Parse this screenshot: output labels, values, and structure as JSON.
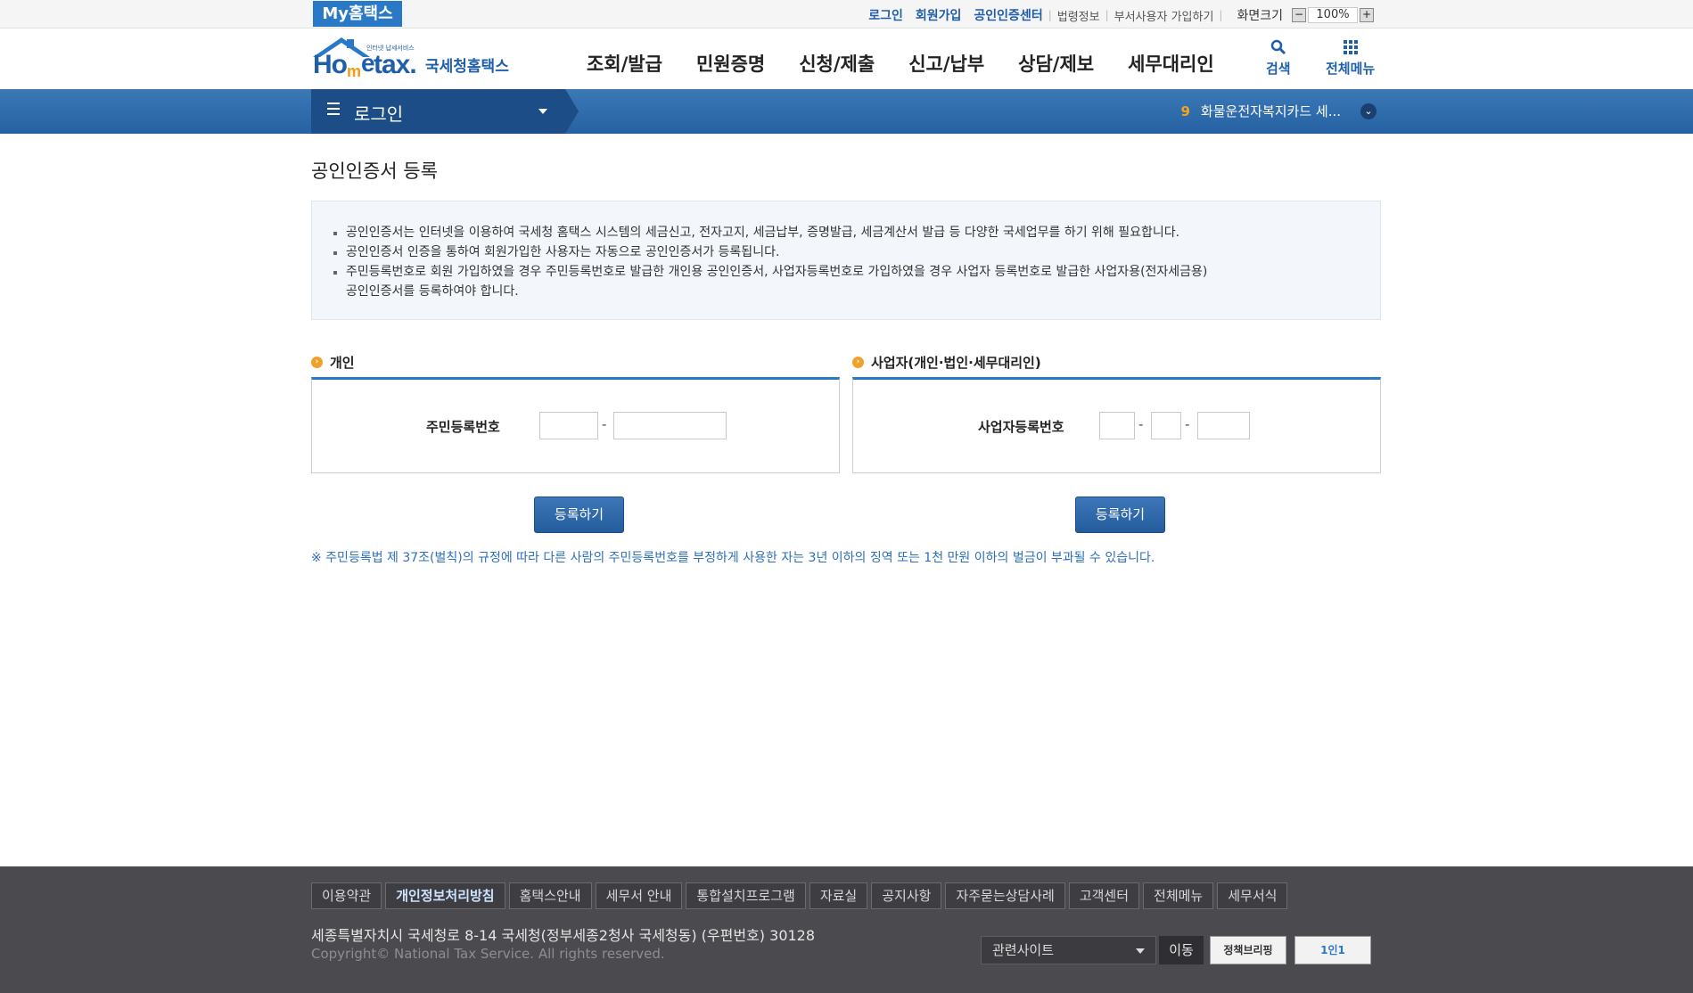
{
  "topbar": {
    "my_hometax": "My홈택스",
    "links": [
      "로그인",
      "회원가입",
      "공인인증센터"
    ],
    "sub_links": [
      "법령정보",
      "부서사용자 가입하기"
    ],
    "zoom_label": "화면크기",
    "zoom_minus": "−",
    "zoom_value": "100%",
    "zoom_plus": "+"
  },
  "header": {
    "logo_small": "인터넷 납세서비스",
    "logo_main": "Hometax",
    "logo_kor": "국세청홈택스",
    "nav": [
      "조회/발급",
      "민원증명",
      "신청/제출",
      "신고/납부",
      "상담/제보",
      "세무대리인"
    ],
    "search_label": "검색",
    "allmenu_label": "전체메뉴"
  },
  "bluebar": {
    "login_label": "로그인",
    "notice_num": "9",
    "notice_text": "화물운전자복지카드 세..."
  },
  "page": {
    "title": "공인인증서 등록",
    "info": [
      "공인인증서는 인터넷을 이용하여 국세청 홈택스 시스템의 세금신고, 전자고지, 세금납부, 증명발급, 세금계산서 발급 등 다양한 국세업무를 하기 위해 필요합니다.",
      "공인인증서 인증을 통하여 회원가입한 사용자는 자동으로 공인인증서가 등록됩니다.",
      "주민등록번호로 회원 가입하였을 경우 주민등록번호로 발급한 개인용 공인인증서, 사업자등록번호로 가입하였을 경우 사업자 등록번호로 발급한 사업자용(전자세금용)",
      "공인인증서를 등록하여야 합니다."
    ],
    "personal": {
      "title": "개인",
      "label": "주민등록번호",
      "dash": "-",
      "button": "등록하기"
    },
    "business": {
      "title": "사업자(개인·법인·세무대리인)",
      "label": "사업자등록번호",
      "dash": "-",
      "button": "등록하기"
    },
    "warning": "※ 주민등록법 제 37조(벌칙)의 규정에 따라 다른 사람의 주민등록번호를 부정하게 사용한 자는 3년 이하의 징역 또는 1천 만원 이하의 벌금이 부과될 수 있습니다."
  },
  "footer": {
    "links": [
      "이용약관",
      "개인정보처리방침",
      "홈택스안내",
      "세무서 안내",
      "통합설치프로그램",
      "자료실",
      "공지사항",
      "자주묻는상담사례",
      "고객센터",
      "전체메뉴",
      "세무서식"
    ],
    "address": "세종특별자치시 국세청로 8-14 국세청(정부세종2청사 국세청동) (우편번호) 30128",
    "copyright": "Copyright© National Tax Service. All rights reserved.",
    "related_site": "관련사이트",
    "go": "이동",
    "banner1": "정책브리핑",
    "banner2": "1인1"
  }
}
